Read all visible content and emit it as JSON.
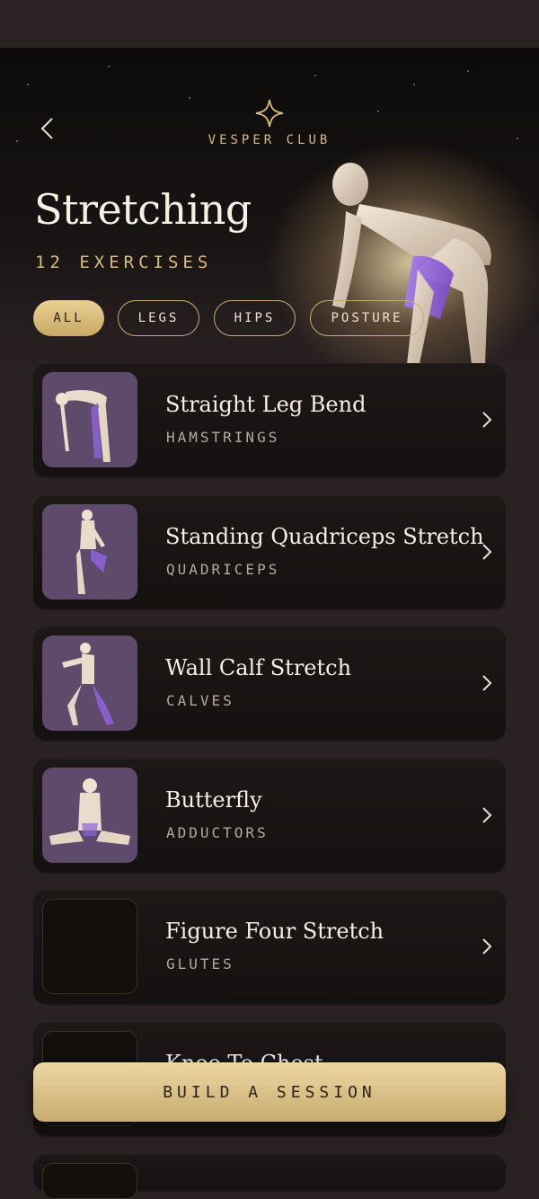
{
  "header": {
    "brand": "VESPER CLUB",
    "title": "Stretching",
    "subtitle": "12 EXERCISES"
  },
  "filters": [
    {
      "label": "ALL",
      "active": true
    },
    {
      "label": "LEGS",
      "active": false
    },
    {
      "label": "HIPS",
      "active": false
    },
    {
      "label": "POSTURE",
      "active": false
    }
  ],
  "exercises": [
    {
      "name": "Straight Leg Bend",
      "muscle": "HAMSTRINGS"
    },
    {
      "name": "Standing Quadriceps Stretch",
      "muscle": "QUADRICEPS"
    },
    {
      "name": "Wall Calf Stretch",
      "muscle": "CALVES"
    },
    {
      "name": "Butterfly",
      "muscle": "ADDUCTORS"
    },
    {
      "name": "Figure Four Stretch",
      "muscle": "GLUTES"
    },
    {
      "name": "Knee To Chest",
      "muscle": ""
    }
  ],
  "cta": {
    "label": "BUILD A SESSION"
  },
  "icons": {
    "back": "chevron-left-icon",
    "logo": "four-point-star-icon",
    "row": "chevron-right-icon"
  },
  "colors": {
    "gold": "#d8bb7d",
    "muscle_highlight": "#9b6be0",
    "background": "#2a2222"
  }
}
